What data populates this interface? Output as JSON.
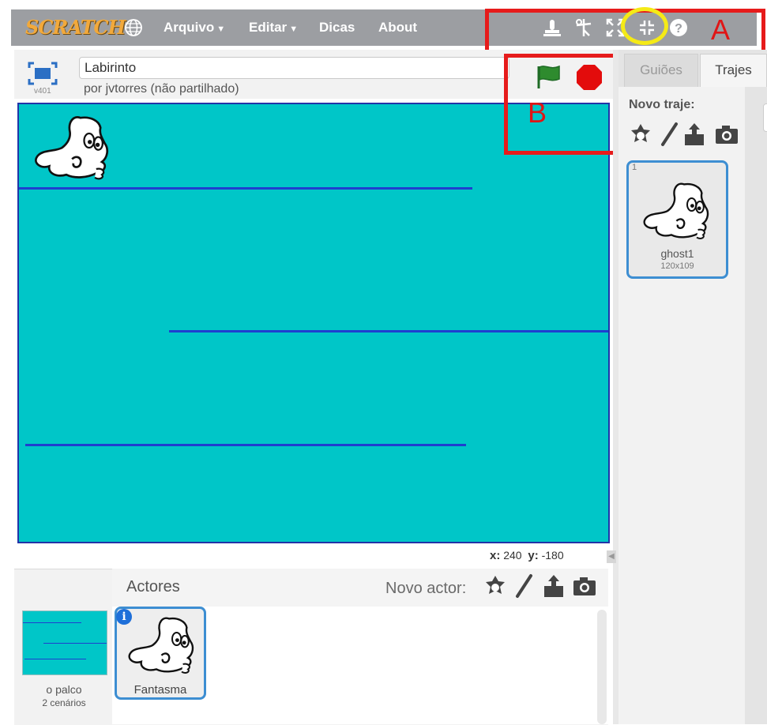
{
  "menubar": {
    "logo": "SCRATCH",
    "items": [
      {
        "label": "Arquivo",
        "dropdown": true
      },
      {
        "label": "Editar",
        "dropdown": true
      },
      {
        "label": "Dicas",
        "dropdown": false
      },
      {
        "label": "About",
        "dropdown": false
      }
    ],
    "tools": [
      "duplicate-icon",
      "cut-icon",
      "grow-icon",
      "shrink-icon",
      "help-icon"
    ]
  },
  "annotations": {
    "a_label": "A",
    "b_label": "B",
    "box_color": "#e61b1b",
    "highlight_color": "#f5ea16"
  },
  "project": {
    "title": "Labirinto",
    "author_line": "por jvtorres (não partilhado)",
    "version": "v401"
  },
  "stage": {
    "background_color": "#00c6c8",
    "mouse_x_label": "x:",
    "mouse_x": "240",
    "mouse_y_label": "y:",
    "mouse_y": "-180"
  },
  "sprites_panel": {
    "title": "Actores",
    "new_sprite_label": "Novo actor:",
    "stage_label": "o palco",
    "stage_backdrops": "2 cenários",
    "sprites": [
      {
        "name": "Fantasma"
      }
    ]
  },
  "right_panel": {
    "tabs": [
      {
        "label": "Guiões",
        "active": false
      },
      {
        "label": "Trajes",
        "active": true
      }
    ],
    "new_costume_label": "Novo traje:",
    "costumes": [
      {
        "index": "1",
        "name": "ghost1",
        "size": "120x109"
      }
    ]
  }
}
